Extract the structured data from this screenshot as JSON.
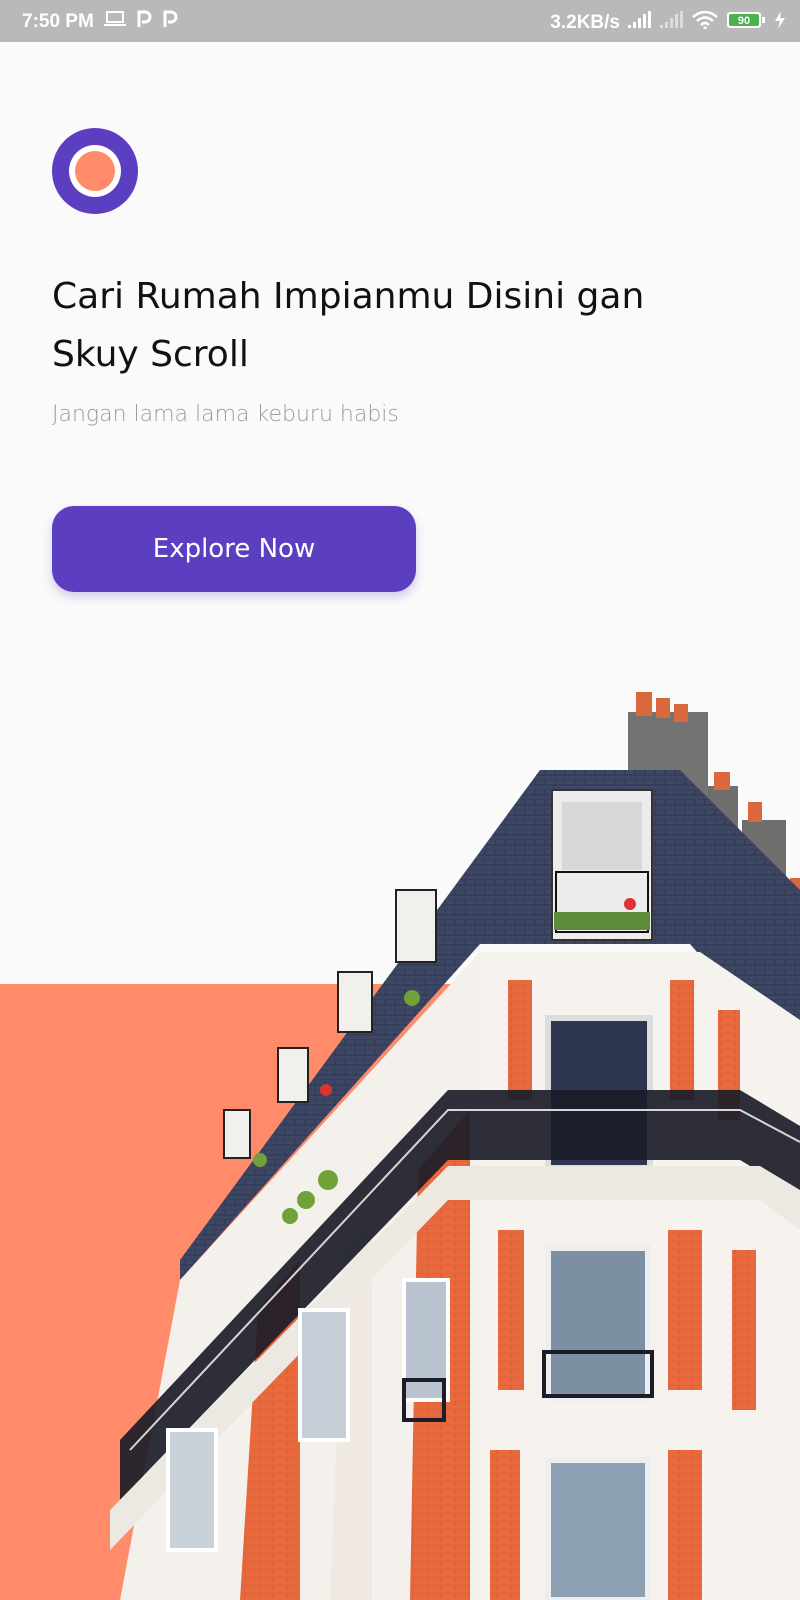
{
  "status_bar": {
    "time": "7:50 PM",
    "net_speed": "3.2KB/s",
    "battery": "90",
    "icons": [
      "laptop-icon",
      "p-notification-icon",
      "p-notification-icon",
      "signal-icon",
      "signal-icon",
      "wifi-icon",
      "battery-icon",
      "charging-icon"
    ]
  },
  "hero": {
    "title": "Cari Rumah Impianmu Disini gan Skuy Scroll",
    "subtitle": "Jangan lama lama keburu habis",
    "button_label": "Explore Now"
  },
  "colors": {
    "primary": "#5c3fc1",
    "accent": "#ff8b6b",
    "background": "#fafafa",
    "subtitle": "#9a9a9a"
  }
}
